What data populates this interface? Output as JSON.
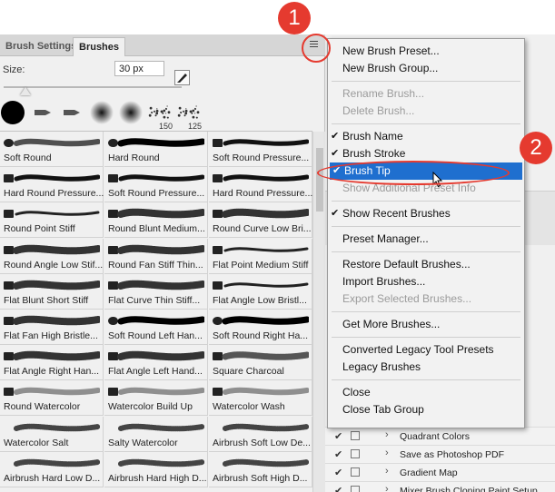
{
  "tabs": {
    "brush_settings": "Brush Settings",
    "brushes": "Brushes"
  },
  "size": {
    "label": "Size:",
    "value": "30 px"
  },
  "recent_brushes": [
    {
      "type": "hard-round"
    },
    {
      "type": "tool"
    },
    {
      "type": "tool"
    },
    {
      "type": "soft-round"
    },
    {
      "type": "soft-round"
    },
    {
      "type": "spatter",
      "number": "150"
    },
    {
      "type": "spatter",
      "number": "125"
    }
  ],
  "brushes": [
    {
      "name": "Soft Round",
      "style": "soft"
    },
    {
      "name": "Hard Round",
      "style": "hard"
    },
    {
      "name": "Soft Round Pressure...",
      "style": "soft-taper"
    },
    {
      "name": "Hard Round Pressure...",
      "style": "hard-taper"
    },
    {
      "name": "Soft Round Pressure...",
      "style": "soft-taper"
    },
    {
      "name": "Hard Round Pressure...",
      "style": "hard-taper"
    },
    {
      "name": "Round Point Stiff",
      "style": "point"
    },
    {
      "name": "Round Blunt Medium...",
      "style": "bristle"
    },
    {
      "name": "Round Curve Low Bri...",
      "style": "bristle"
    },
    {
      "name": "Round Angle Low Stif...",
      "style": "angle"
    },
    {
      "name": "Round Fan Stiff Thin...",
      "style": "fan"
    },
    {
      "name": "Flat Point Medium Stiff",
      "style": "point"
    },
    {
      "name": "Flat Blunt Short Stiff",
      "style": "bristle"
    },
    {
      "name": "Flat Curve Thin Stiff...",
      "style": "angle"
    },
    {
      "name": "Flat Angle Low Bristl...",
      "style": "point"
    },
    {
      "name": "Flat Fan High Bristle...",
      "style": "fan"
    },
    {
      "name": "Soft Round Left Han...",
      "style": "hard"
    },
    {
      "name": "Soft Round Right Ha...",
      "style": "hard"
    },
    {
      "name": "Flat Angle Right Han...",
      "style": "angle"
    },
    {
      "name": "Flat Angle Left Hand...",
      "style": "angle"
    },
    {
      "name": "Square Charcoal",
      "style": "charcoal"
    },
    {
      "name": "Round Watercolor",
      "style": "watercolor"
    },
    {
      "name": "Watercolor Build Up",
      "style": "watercolor"
    },
    {
      "name": "Watercolor Wash",
      "style": "watercolor"
    },
    {
      "name": "Watercolor Salt",
      "style": "salt"
    },
    {
      "name": "Salty Watercolor",
      "style": "salt"
    },
    {
      "name": "Airbrush Soft Low De...",
      "style": "airbrush"
    },
    {
      "name": "Airbrush Hard Low D...",
      "style": "airbrush"
    },
    {
      "name": "Airbrush Hard High D...",
      "style": "airbrush"
    },
    {
      "name": "Airbrush Soft High D...",
      "style": "airbrush"
    }
  ],
  "menu": {
    "items": [
      {
        "label": "New Brush Preset...",
        "enabled": true,
        "checked": false
      },
      {
        "label": "New Brush Group...",
        "enabled": true,
        "checked": false
      },
      {
        "separator": true
      },
      {
        "label": "Rename Brush...",
        "enabled": false,
        "checked": false
      },
      {
        "label": "Delete Brush...",
        "enabled": false,
        "checked": false
      },
      {
        "separator": true
      },
      {
        "label": "Brush Name",
        "enabled": true,
        "checked": true
      },
      {
        "label": "Brush Stroke",
        "enabled": true,
        "checked": true
      },
      {
        "label": "Brush Tip",
        "enabled": true,
        "checked": true,
        "selected": true
      },
      {
        "label": "Show Additional Preset Info",
        "enabled": false,
        "checked": false
      },
      {
        "separator": true
      },
      {
        "label": "Show Recent Brushes",
        "enabled": true,
        "checked": true
      },
      {
        "separator": true
      },
      {
        "label": "Preset Manager...",
        "enabled": true,
        "checked": false
      },
      {
        "separator": true
      },
      {
        "label": "Restore Default Brushes...",
        "enabled": true,
        "checked": false
      },
      {
        "label": "Import Brushes...",
        "enabled": true,
        "checked": false
      },
      {
        "label": "Export Selected Brushes...",
        "enabled": false,
        "checked": false
      },
      {
        "separator": true
      },
      {
        "label": "Get More Brushes...",
        "enabled": true,
        "checked": false
      },
      {
        "separator": true
      },
      {
        "label": "Converted Legacy Tool Presets",
        "enabled": true,
        "checked": false
      },
      {
        "label": "Legacy Brushes",
        "enabled": true,
        "checked": false
      },
      {
        "separator": true
      },
      {
        "label": "Close",
        "enabled": true,
        "checked": false
      },
      {
        "label": "Close Tab Group",
        "enabled": true,
        "checked": false
      }
    ]
  },
  "actions": [
    {
      "label": "Quadrant Colors"
    },
    {
      "label": "Save as Photoshop PDF"
    },
    {
      "label": "Gradient Map"
    },
    {
      "label": "Mixer Brush Cloning Paint Setup"
    }
  ],
  "annotations": {
    "step1": "1",
    "step2": "2"
  },
  "colors": {
    "accent": "#e53a2f",
    "selection": "#1f6fcf"
  }
}
